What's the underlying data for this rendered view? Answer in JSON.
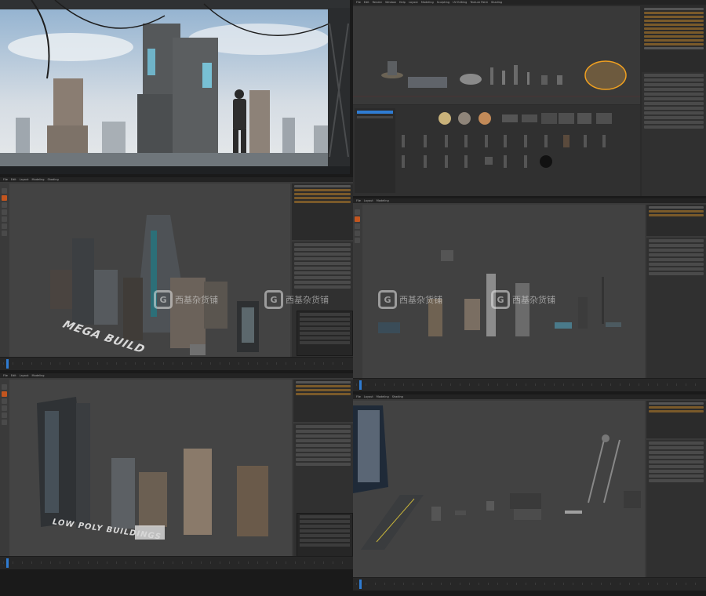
{
  "blender": {
    "menu": [
      "File",
      "Edit",
      "Render",
      "Window",
      "Help"
    ],
    "workspace_tabs": [
      "Layout",
      "Modeling",
      "Sculpting",
      "UV Editing",
      "Texture Paint",
      "Shading",
      "Animation",
      "Rendering",
      "Compositing",
      "Geometry Nodes",
      "Scripting"
    ]
  },
  "overlays": {
    "mega_buildings": "MEGA BUILD",
    "low_poly": "LOW POLY BUILDINGS"
  },
  "watermark": {
    "glyph": "G",
    "text": "西基杂货铺"
  },
  "colors": {
    "accent_blue": "#2f7cd3",
    "accent_orange": "#c2551f",
    "ui_dark": "#232323",
    "viewport_grey": "#404040"
  }
}
